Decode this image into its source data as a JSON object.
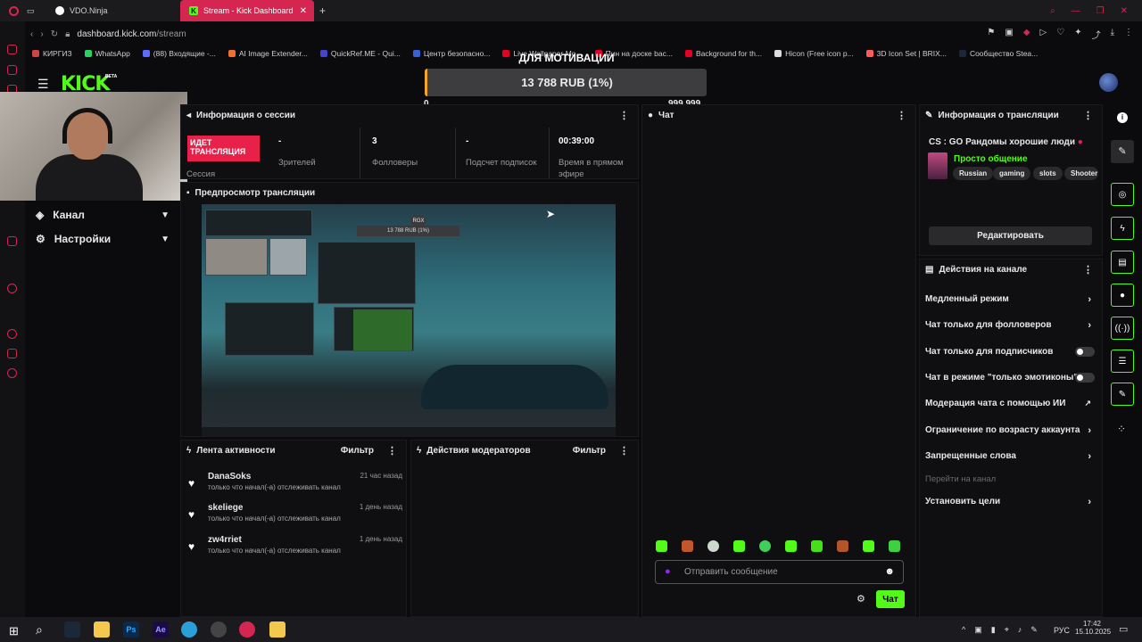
{
  "browser": {
    "tabs": [
      {
        "label": "VDO.Ninja"
      },
      {
        "label": "Stream - Kick Dashboard"
      }
    ],
    "url_host": "dashboard.kick.com",
    "url_path": "/stream",
    "bookmarks": [
      "КИРГИЗ",
      "WhatsApp",
      "(88) Входящие -...",
      "AI Image Extender...",
      "QuickRef.ME - Qui...",
      "Центр безопасно...",
      "Live Wallpaper Mo...",
      "Пин на доске bac...",
      "Background for th...",
      "Hicon (Free icon p...",
      "3D Icon Set | BRIX...",
      "Сообщество Stea..."
    ]
  },
  "header": {
    "logo": "KICK",
    "logo_badge": "BETA",
    "goal_title": "ДЛЯ МОТИВАЦИИ",
    "goal_value": "13 788 RUB (1%)",
    "goal_progress_percent": 1,
    "goal_min": "0",
    "goal_max": "999 999"
  },
  "sidebar": {
    "items": [
      {
        "label": "Канал"
      },
      {
        "label": "Настройки"
      }
    ]
  },
  "session": {
    "title": "Информация о сессии",
    "live_label": "ИДЕТ ТРАНСЛЯЦИЯ",
    "session_label": "Сессия",
    "stats": [
      {
        "value": "-",
        "label": "Зрителей"
      },
      {
        "value": "3",
        "label": "Фолловеры"
      },
      {
        "value": "-",
        "label": "Подсчет подписок"
      },
      {
        "value": "00:39:00",
        "label": "Время в прямом эфире"
      }
    ]
  },
  "preview": {
    "title": "Предпросмотр трансляции",
    "overlay_goal": "13 788 RUB (1%)",
    "overlay_code": "RGX"
  },
  "activity": {
    "title": "Лента активности",
    "filter": "Фильтр",
    "items": [
      {
        "name": "DanaSoks",
        "desc": "только что начал(-а) отслеживать канал",
        "time": "21 час назад"
      },
      {
        "name": "skeliege",
        "desc": "только что начал(-а) отслеживать канал",
        "time": "1 день назад"
      },
      {
        "name": "zw4rriet",
        "desc": "только что начал(-а) отслеживать канал",
        "time": "1 день назад"
      }
    ]
  },
  "mod_actions": {
    "title": "Действия модераторов",
    "filter": "Фильтр"
  },
  "chat": {
    "title": "Чат",
    "placeholder": "Отправить сообщение",
    "send_label": "Чат"
  },
  "stream_info": {
    "title": "Информация о трансляции",
    "stream_title": "CS : GO Рандомы хорошие люди",
    "category": "Просто общение",
    "tags": [
      "Russian",
      "gaming",
      "slots",
      "Shooter"
    ],
    "edit_label": "Редактировать"
  },
  "channel_actions": {
    "title": "Действия на канале",
    "items": [
      {
        "label": "Медленный режим"
      },
      {
        "label": "Чат только для фолловеров"
      },
      {
        "label": "Чат только для подписчиков"
      },
      {
        "label": "Чат в режиме \"только эмотиконы\""
      },
      {
        "label": "Модерация чата с помощью ИИ"
      },
      {
        "label": "Ограничение по возрасту аккаунта"
      },
      {
        "label": "Запрещенные слова"
      },
      {
        "label": "Перейти на канал"
      },
      {
        "label": "Установить цели"
      }
    ]
  },
  "taskbar": {
    "lang": "РУС",
    "time": "17:42",
    "date": "15.10.2025"
  },
  "colors": {
    "accent": "#53fc18",
    "live": "#e8204a",
    "tab_active": "#d42650",
    "goal_bar": "#f5a623"
  }
}
